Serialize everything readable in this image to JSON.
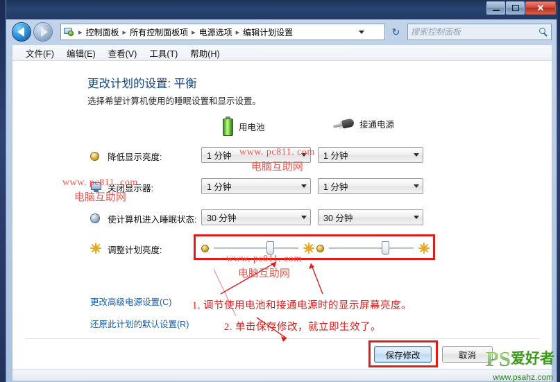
{
  "window": {
    "controls": {
      "minimize": "–",
      "maximize": "□",
      "close": "✕"
    }
  },
  "addressbar": {
    "back_tooltip": "后退",
    "forward_tooltip": "前进",
    "breadcrumbs": [
      "控制面板",
      "所有控制面板项",
      "电源选项",
      "编辑计划设置"
    ],
    "separator": "▸",
    "refresh_glyph": "↻",
    "search_placeholder": "搜索控制面板",
    "search_value": ""
  },
  "menubar": {
    "items": [
      "文件(F)",
      "编辑(E)",
      "查看(V)",
      "工具(T)",
      "帮助(H)"
    ]
  },
  "page": {
    "title": "更改计划的设置: 平衡",
    "subtitle": "选择希望计算机使用的睡眠设置和显示设置。"
  },
  "columns": [
    {
      "label": "用电池",
      "icon": "battery-icon"
    },
    {
      "label": "接通电源",
      "icon": "power-plug-icon"
    }
  ],
  "settings": [
    {
      "label": "降低显示亮度:",
      "icon": "dim-brightness-icon",
      "battery_value": "1 分钟",
      "plugged_value": "1 分钟"
    },
    {
      "label": "关闭显示器:",
      "icon": "monitor-icon",
      "battery_value": "1 分钟",
      "plugged_value": "1 分钟"
    },
    {
      "label": "使计算机进入睡眠状态:",
      "icon": "sleep-moon-icon",
      "battery_value": "30 分钟",
      "plugged_value": "30 分钟"
    }
  ],
  "brightness_row": {
    "label": "调整计划亮度:",
    "icon": "sun-icon",
    "battery_slider_percent": 62,
    "plugged_slider_percent": 62
  },
  "links": [
    "更改高级电源设置(C)",
    "还原此计划的默认设置(R)"
  ],
  "footer": {
    "save_label": "保存修改",
    "cancel_label": "取消"
  },
  "annotations": [
    "1. 调节使用电池和接通电源时的显示屏幕亮度。",
    "2. 单击保存修改，就立即生效了。"
  ],
  "watermarks": [
    {
      "url": "www. pc811. com",
      "cn": "电脑互助网"
    },
    {
      "url": "www. pc811. com",
      "cn": "电脑互助网"
    },
    {
      "url": "www. pc811. com",
      "cn": "电脑互助网"
    }
  ],
  "branding": {
    "ps": "PS",
    "cn": "爱好者",
    "url": "www.psahz.com"
  },
  "colors": {
    "accent_red": "#e01b1b",
    "watermark_red": "#f0453d",
    "title_blue": "#14477d",
    "link_blue": "#1b5fa8",
    "brand_green": "#3c9a1c"
  }
}
